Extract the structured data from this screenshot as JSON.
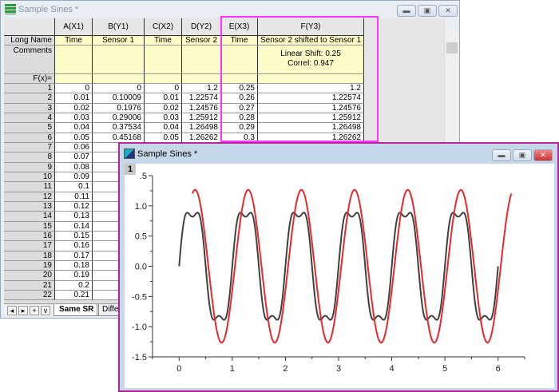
{
  "workbook": {
    "title": "Sample Sines *",
    "columns": [
      {
        "name": "A(X1)",
        "long_name": "Time"
      },
      {
        "name": "B(Y1)",
        "long_name": "Sensor 1"
      },
      {
        "name": "C(X2)",
        "long_name": "Time"
      },
      {
        "name": "D(Y2)",
        "long_name": "Sensor 2"
      },
      {
        "name": "E(X3)",
        "long_name": "Time"
      },
      {
        "name": "F(Y3)",
        "long_name": "Sensor 2 shifted to Sensor 1"
      }
    ],
    "row_labels": {
      "long_name": "Long Name",
      "comments": "Comments",
      "fx": "F(x)="
    },
    "comment_f": [
      "Linear Shift: 0.25",
      "Correl: 0.947"
    ],
    "rows": [
      [
        "0",
        "0",
        "0",
        "1.2",
        "0.25",
        "1.2"
      ],
      [
        "0.01",
        "0.10009",
        "0.01",
        "1.22574",
        "0.26",
        "1.22574"
      ],
      [
        "0.02",
        "0.1976",
        "0.02",
        "1.24576",
        "0.27",
        "1.24576"
      ],
      [
        "0.03",
        "0.29006",
        "0.03",
        "1.25912",
        "0.28",
        "1.25912"
      ],
      [
        "0.04",
        "0.37534",
        "0.04",
        "1.26498",
        "0.29",
        "1.26498"
      ],
      [
        "0.05",
        "0.45168",
        "0.05",
        "1.26262",
        "0.3",
        "1.26262"
      ],
      [
        "0.06"
      ],
      [
        "0.07"
      ],
      [
        "0.08"
      ],
      [
        "0.09"
      ],
      [
        "0.1"
      ],
      [
        "0.11"
      ],
      [
        "0.12"
      ],
      [
        "0.13"
      ],
      [
        "0.14"
      ],
      [
        "0.15"
      ],
      [
        "0.16"
      ],
      [
        "0.17"
      ],
      [
        "0.18"
      ],
      [
        "0.19"
      ],
      [
        "0.2"
      ],
      [
        "0.21"
      ]
    ],
    "sheet_tabs": [
      "Same SR",
      "Differe"
    ],
    "tab_buttons": [
      "◂",
      "▸",
      "+",
      "v"
    ]
  },
  "graph": {
    "title": "Sample Sines *",
    "layer": "1",
    "x_ticks": [
      "0",
      "1",
      "2",
      "3",
      "4",
      "5",
      "6"
    ],
    "y_ticks": [
      "-1.5",
      "-1.0",
      "-0.5",
      "0.0",
      "0.5",
      "1.0",
      ".5"
    ],
    "xlim": [
      -0.5,
      6.5
    ],
    "ylim": [
      -1.5,
      1.5
    ],
    "series_colors": {
      "sensor1": "#404040",
      "shifted": "#e8282c"
    }
  },
  "window_buttons": {
    "min": "▬",
    "max": "▣",
    "close": "✕"
  }
}
